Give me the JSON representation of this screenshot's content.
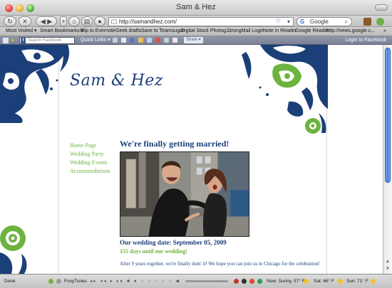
{
  "window": {
    "title": "Sam & Hez"
  },
  "toolbar": {
    "url": "http://samandhez.com/",
    "search_placeholder": "Google"
  },
  "bookmarks": [
    "Most Visited ▾",
    "Smart Bookmarks ▾",
    "Clip to Evernote",
    "Geek drafts",
    "Save to Teamsugar",
    "Digital Stock Photog...",
    "StrongMail Login",
    "Note in Reader",
    "Google Reader",
    "http://news.google.c..."
  ],
  "bookmarks_overflow": "»",
  "facebook_bar": {
    "search_placeholder": "Search Facebook",
    "quick_links": "Quick Links ▾",
    "share": "Share ▾",
    "login": "Login to Facebook"
  },
  "page": {
    "logo": "Sam & Hez",
    "nav": [
      "Home Page",
      "Wedding Party",
      "Wedding Events",
      "Accommodations"
    ],
    "heading": "We're finally getting married!",
    "date_line": "Our wedding date: September 05, 2009",
    "countdown": "155 days until our wedding!",
    "intro": "After 9 years together, we're finally doin' it! We hope you can join us in Chicago for the celebration!"
  },
  "statusbar": {
    "status": "Done",
    "foxytunes": "FoxyTunes",
    "weather_now": "Now: Sunny, 57° F",
    "weather_sat": "Sat: 66° F",
    "weather_sun": "Sun: 71° F"
  },
  "colors": {
    "navy": "#1b3f78",
    "green": "#6cb33f"
  }
}
